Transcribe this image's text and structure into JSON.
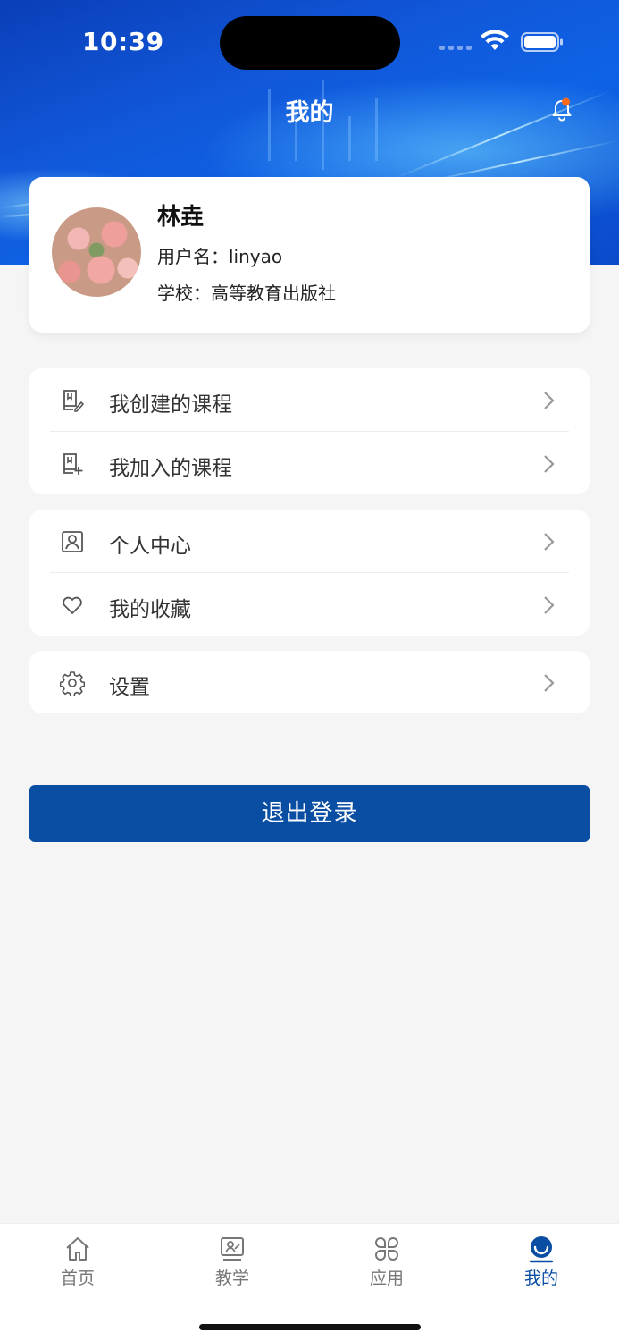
{
  "status": {
    "time": "10:39"
  },
  "nav": {
    "title": "我的"
  },
  "profile": {
    "name": "林垚",
    "username_line": "用户名：linyao",
    "school_line": "学校：高等教育出版社"
  },
  "menu": {
    "group1": [
      {
        "label": "我创建的课程",
        "icon": "book-edit-icon"
      },
      {
        "label": "我加入的课程",
        "icon": "book-add-icon"
      }
    ],
    "group2": [
      {
        "label": "个人中心",
        "icon": "user-card-icon"
      },
      {
        "label": "我的收藏",
        "icon": "heart-icon"
      }
    ],
    "group3": [
      {
        "label": "设置",
        "icon": "gear-icon"
      }
    ]
  },
  "logout_label": "退出登录",
  "tabs": [
    {
      "label": "首页",
      "icon": "home-icon"
    },
    {
      "label": "教学",
      "icon": "teaching-icon"
    },
    {
      "label": "应用",
      "icon": "apps-icon"
    },
    {
      "label": "我的",
      "icon": "profile-icon",
      "active": true
    }
  ],
  "colors": {
    "primary": "#0a4ea4",
    "background": "#f5f5f5",
    "notification_dot": "#ff6a1a"
  }
}
